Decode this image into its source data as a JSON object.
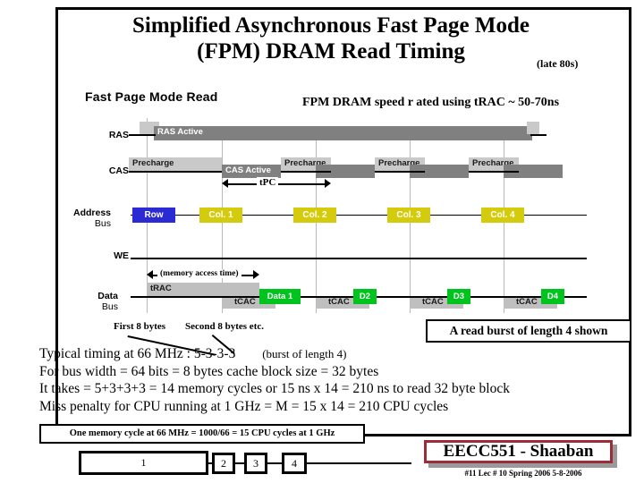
{
  "slide": {
    "title_line1": "Simplified Asynchronous Fast Page Mode",
    "title_line2": "(FPM)  DRAM Read Timing",
    "title_note": "(late 80s)",
    "diagram_heading": "Fast Page Mode Read",
    "speed_note": "FPM DRAM speed r ated using tRAC ~  50-70ns"
  },
  "timing": {
    "rows": [
      {
        "name": "RAS",
        "label_line1": "RAS",
        "label_line2": ""
      },
      {
        "name": "CAS",
        "label_line1": "CAS",
        "label_line2": ""
      },
      {
        "name": "address-bus",
        "label_line1": "Address",
        "label_line2": "Bus"
      },
      {
        "name": "WE",
        "label_line1": "WE",
        "label_line2": ""
      },
      {
        "name": "data-bus",
        "label_line1": "Data",
        "label_line2": "Bus"
      }
    ],
    "ras_active_label": "RAS Active",
    "cas_active_label": "CAS Active",
    "precharge_labels": [
      "Precharge",
      "Precharge",
      "Precharge",
      "Precharge"
    ],
    "tpc_label": "tPC",
    "access_time_label": "(memory access time)",
    "trac_label": "tRAC",
    "tcac_labels": [
      "tCAC",
      "tCAC",
      "tCAC",
      "tCAC"
    ],
    "address_boxes": [
      "Row",
      "Col. 1",
      "Col. 2",
      "Col. 3",
      "Col. 4"
    ],
    "data_boxes": [
      "Data 1",
      "D2",
      "D3",
      "D4"
    ],
    "colors": {
      "row_box": "#2b2bd4",
      "col_box": "#d4cb0c",
      "data_box": "#00c41e",
      "active_bar": "#808080",
      "precharge_bar": "#c9c9c9"
    }
  },
  "annotations": {
    "first8": "First 8 bytes",
    "second8": "Second 8 bytes  etc.",
    "burst_box": "A read burst of length 4 shown"
  },
  "body": {
    "line1_a": "Typical timing at  66 MHz :   5-3-3-3",
    "line1_b": "(burst of length 4)",
    "line2": "For bus width = 64 bits =  8 bytes       cache  block size = 32 bytes",
    "line3": "It takes  =  5+3+3+3  =  14 memory cycles  or    15  ns  x 14 =  210 ns  to read 32 byte block",
    "line4": "Miss penalty for CPU  running at 1 GHz  = M =    15 x 14  =  210  CPU cycles",
    "cycle_box": "One memory cycle at 66 MHz =  1000/66 = 15 CPU cycles at 1 GHz"
  },
  "nav": {
    "boxes": [
      "1",
      "2",
      "3",
      "4"
    ]
  },
  "signature": {
    "text": "EECC551 - Shaaban",
    "footer": "#11  Lec # 10  Spring 2006  5-8-2006",
    "border_color": "#9e2b38"
  }
}
